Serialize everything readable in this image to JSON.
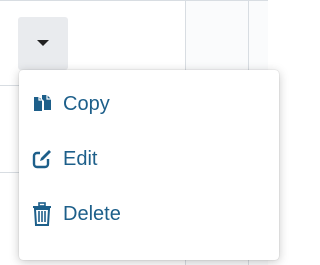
{
  "colors": {
    "menu_text": "#1d5f8a",
    "toggle_bg": "#e9ebee",
    "grid_line": "#d8dde2"
  },
  "dropdown": {
    "toggle_icon": "caret-down-icon"
  },
  "menu": {
    "items": [
      {
        "label": "Copy",
        "icon": "copy-icon"
      },
      {
        "label": "Edit",
        "icon": "edit-icon"
      },
      {
        "label": "Delete",
        "icon": "trash-icon"
      }
    ]
  }
}
